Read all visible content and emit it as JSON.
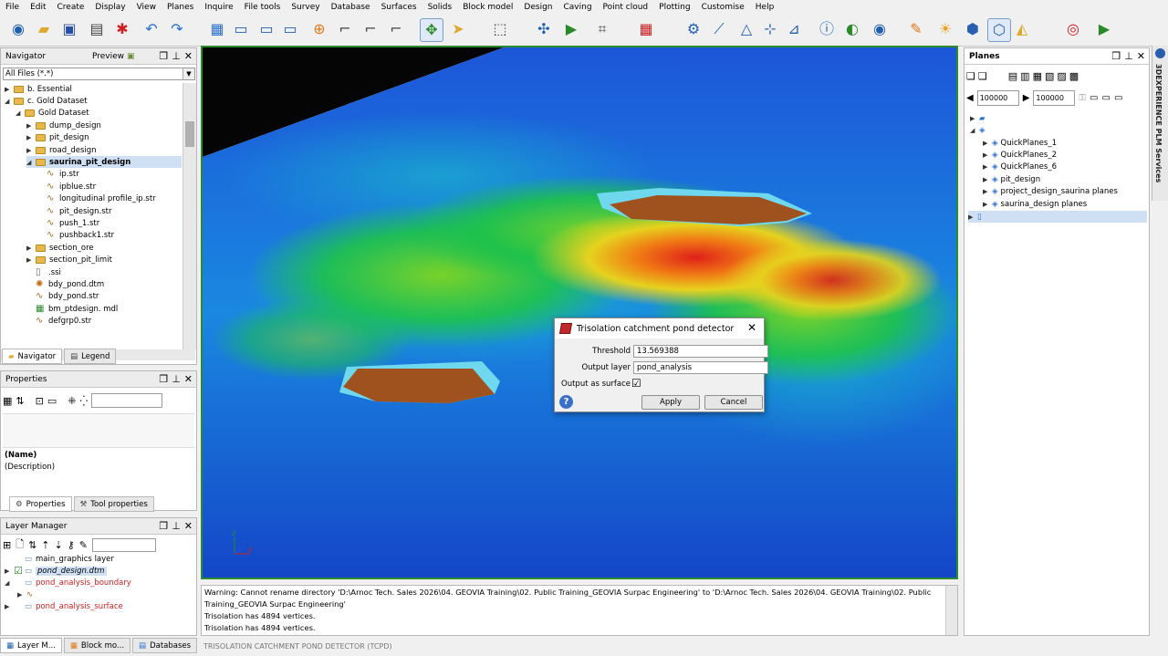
{
  "menu": [
    "File",
    "Edit",
    "Create",
    "Display",
    "View",
    "Planes",
    "Inquire",
    "File tools",
    "Survey",
    "Database",
    "Surfaces",
    "Solids",
    "Block model",
    "Design",
    "Caving",
    "Point cloud",
    "Plotting",
    "Customise",
    "Help"
  ],
  "toolbar_icons": [
    "globe-icon",
    "open-folder-icon",
    "save-icon",
    "print-icon",
    "redraw-icon",
    "undo-icon",
    "redo-icon",
    "grid-icon",
    "view-monitor-icon",
    "zoom-in-icon",
    "zoom-out-icon",
    "crosshair-icon",
    "xy-plane-icon",
    "yz-plane-icon",
    "xz-plane-icon",
    "rotate-icon",
    "pointer-icon",
    "select-box-icon",
    "move-icon",
    "flag-icon",
    "snap-icon",
    "grid-snap-icon",
    "digitise-icon",
    "line-icon",
    "triangle-icon",
    "polyline-icon",
    "section-icon",
    "info-icon",
    "camera-icon",
    "eye-icon",
    "pen-icon",
    "sun-icon",
    "hexagon-icon",
    "wireframe-icon",
    "paint-icon",
    "target-icon",
    "play-icon"
  ],
  "navigator": {
    "title": "Navigator",
    "preview": "Preview",
    "filter": "All Files (*.*)",
    "items": [
      {
        "label": "b. Essential",
        "type": "folder",
        "indent": 0,
        "arrow": "▶"
      },
      {
        "label": "c. Gold Dataset",
        "type": "folder",
        "indent": 0,
        "arrow": "◢"
      },
      {
        "label": "Gold Dataset",
        "type": "folder",
        "indent": 1,
        "arrow": "◢"
      },
      {
        "label": "dump_design",
        "type": "folder",
        "indent": 2,
        "arrow": "▶"
      },
      {
        "label": "pit_design",
        "type": "folder",
        "indent": 2,
        "arrow": "▶"
      },
      {
        "label": "road_design",
        "type": "folder",
        "indent": 2,
        "arrow": "▶"
      },
      {
        "label": "saurina_pit_design",
        "type": "folder",
        "indent": 2,
        "arrow": "◢",
        "selected": true
      },
      {
        "label": "ip.str",
        "type": "str",
        "indent": 3
      },
      {
        "label": "ipblue.str",
        "type": "str",
        "indent": 3
      },
      {
        "label": "longitudinal profile_ip.str",
        "type": "str",
        "indent": 3
      },
      {
        "label": "pit_design.str",
        "type": "str",
        "indent": 3
      },
      {
        "label": "push_1.str",
        "type": "str",
        "indent": 3
      },
      {
        "label": "pushback1.str",
        "type": "str",
        "indent": 3
      },
      {
        "label": "section_ore",
        "type": "folder",
        "indent": 2,
        "arrow": "▶"
      },
      {
        "label": "section_pit_limit",
        "type": "folder",
        "indent": 2,
        "arrow": "▶"
      },
      {
        "label": ".ssi",
        "type": "file",
        "indent": 2
      },
      {
        "label": "bdy_pond.dtm",
        "type": "dtm",
        "indent": 2
      },
      {
        "label": "bdy_pond.str",
        "type": "str",
        "indent": 2
      },
      {
        "label": "bm_ptdesign. mdl",
        "type": "mdl",
        "indent": 2
      },
      {
        "label": "defgrp0.str",
        "type": "str",
        "indent": 2
      }
    ],
    "tabs": [
      "Navigator",
      "Legend"
    ]
  },
  "properties": {
    "title": "Properties",
    "name": "(Name)",
    "description": "(Description)",
    "tabs": [
      "Properties",
      "Tool properties"
    ]
  },
  "layers": {
    "title": "Layer Manager",
    "items": [
      {
        "label": "main_graphics layer",
        "color": "#000000",
        "checked": false,
        "italic": false,
        "arrow": ""
      },
      {
        "label": "pond_design.dtm",
        "color": "#000000",
        "checked": true,
        "italic": true,
        "arrow": "▶",
        "selected": true
      },
      {
        "label": "pond_analysis_boundary",
        "color": "#d02020",
        "checked": false,
        "italic": false,
        "arrow": "◢"
      },
      {
        "label": "",
        "color": "#000000",
        "checked": false,
        "italic": false,
        "arrow": "▶"
      },
      {
        "label": "pond_analysis_surface",
        "color": "#d02020",
        "checked": false,
        "italic": false,
        "arrow": "▶"
      }
    ],
    "tabs": [
      "Layer M...",
      "Block mo...",
      "Databases"
    ]
  },
  "planes": {
    "title": "Planes",
    "input1": "100000",
    "input2": "100000",
    "items": [
      {
        "label": "QuickPlanes_1"
      },
      {
        "label": "QuickPlanes_2"
      },
      {
        "label": "QuickPlanes_6"
      },
      {
        "label": "pit_design"
      },
      {
        "label": "project_design_saurina planes"
      },
      {
        "label": "saurina_design planes"
      }
    ]
  },
  "side_tab": "3DEXPERIENCE PLM Services",
  "dialog": {
    "title": "Trisolation catchment pond detector",
    "threshold_label": "Threshold",
    "threshold_value": "13.569388",
    "output_layer_label": "Output layer",
    "output_layer_value": "pond_analysis",
    "output_surface_label": "Output as surface",
    "output_surface_checked": "☑",
    "apply": "Apply",
    "cancel": "Cancel"
  },
  "console": [
    "Warning: Cannot rename directory 'D:\\Arnoc Tech. Sales 2026\\04. GEOVIA Training\\02. Public Training_GEOVIA Surpac Engineering' to 'D:\\Arnoc Tech. Sales 2026\\04. GEOVIA Training\\02. Public",
    "Training_GEOVIA Surpac Engineering'",
    "Trisolation has 4894 vertices.",
    "Trisolation has 4894 vertices."
  ],
  "status": "TRISOLATION CATCHMENT POND DETECTOR (TCPD)",
  "axes": {
    "z": "Z",
    "x": "X",
    "y": "Y"
  },
  "colors": {
    "viewport_border": "#2d8a2d",
    "pond_fill": "#a0521e",
    "selected_row": "#cfe0f5"
  }
}
